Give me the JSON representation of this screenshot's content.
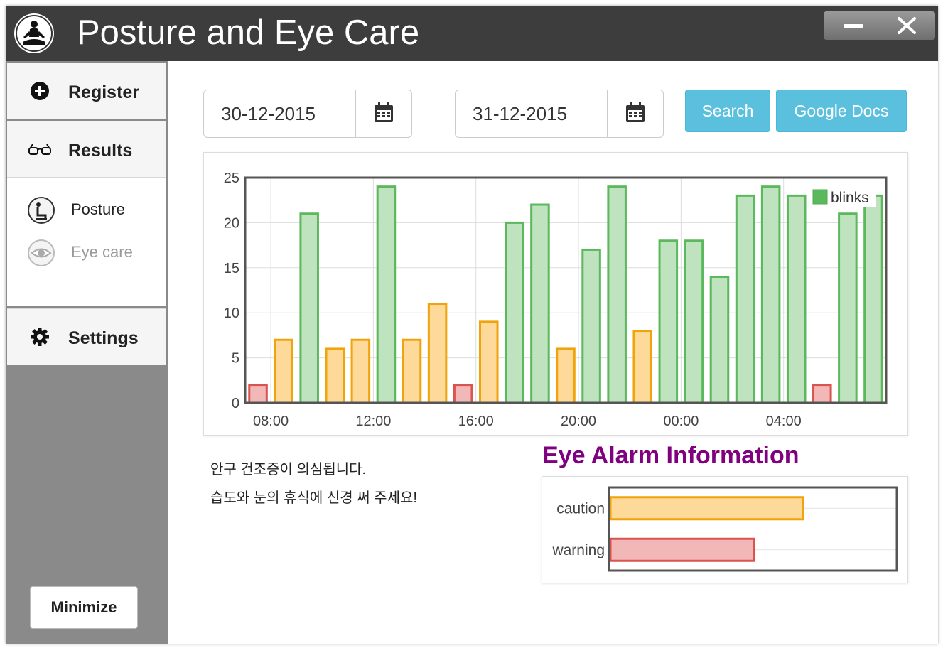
{
  "app": {
    "title": "Posture and Eye Care"
  },
  "window_controls": {
    "minimize_icon": "minimize-icon",
    "close_icon": "close-icon"
  },
  "sidebar": {
    "register": {
      "label": "Register",
      "icon": "plus-circle-icon"
    },
    "results": {
      "label": "Results",
      "icon": "glasses-icon"
    },
    "sub_items": [
      {
        "label": "Posture",
        "icon": "posture-icon",
        "active": true
      },
      {
        "label": "Eye care",
        "icon": "eye-icon",
        "active": false
      }
    ],
    "settings": {
      "label": "Settings",
      "icon": "gear-icon"
    },
    "minimize_label": "Minimize"
  },
  "filters": {
    "start_date": "30-12-2015",
    "end_date": "31-12-2015",
    "search_label": "Search",
    "google_docs_label": "Google Docs"
  },
  "chart_data": [
    {
      "type": "bar",
      "series": [
        {
          "name": "blinks"
        }
      ],
      "values": [
        2,
        7,
        21,
        6,
        7,
        24,
        7,
        11,
        2,
        9,
        20,
        22,
        6,
        17,
        24,
        8,
        18,
        18,
        14,
        23,
        24,
        23,
        2,
        21,
        23
      ],
      "status": [
        "warning",
        "caution",
        "normal",
        "caution",
        "caution",
        "normal",
        "caution",
        "caution",
        "warning",
        "caution",
        "normal",
        "normal",
        "caution",
        "normal",
        "normal",
        "caution",
        "normal",
        "normal",
        "normal",
        "normal",
        "normal",
        "normal",
        "warning",
        "normal",
        "normal"
      ],
      "x_tick_labels": [
        "08:00",
        "12:00",
        "16:00",
        "20:00",
        "00:00",
        "04:00"
      ],
      "y_ticks": [
        0,
        5,
        10,
        15,
        20,
        25
      ],
      "ylim": [
        0,
        25
      ],
      "grid": true,
      "legend": "top-right",
      "colors": {
        "normal": {
          "fill": "#bfe3bf",
          "stroke": "#5cb85c"
        },
        "caution": {
          "fill": "#fdd99a",
          "stroke": "#f0a30a"
        },
        "warning": {
          "fill": "#f2b8b8",
          "stroke": "#d9534f"
        }
      }
    },
    {
      "type": "bar",
      "orientation": "horizontal",
      "title": "Eye Alarm Information",
      "categories": [
        "caution",
        "warning"
      ],
      "values": [
        0.67,
        0.5
      ],
      "colors": [
        {
          "fill": "#fdd99a",
          "stroke": "#f0a30a"
        },
        {
          "fill": "#f2b8b8",
          "stroke": "#d9534f"
        }
      ]
    }
  ],
  "message": {
    "line1": "안구 건조증이 의심됩니다.",
    "line2": "습도와 눈의 휴식에 신경 써 주세요!"
  }
}
